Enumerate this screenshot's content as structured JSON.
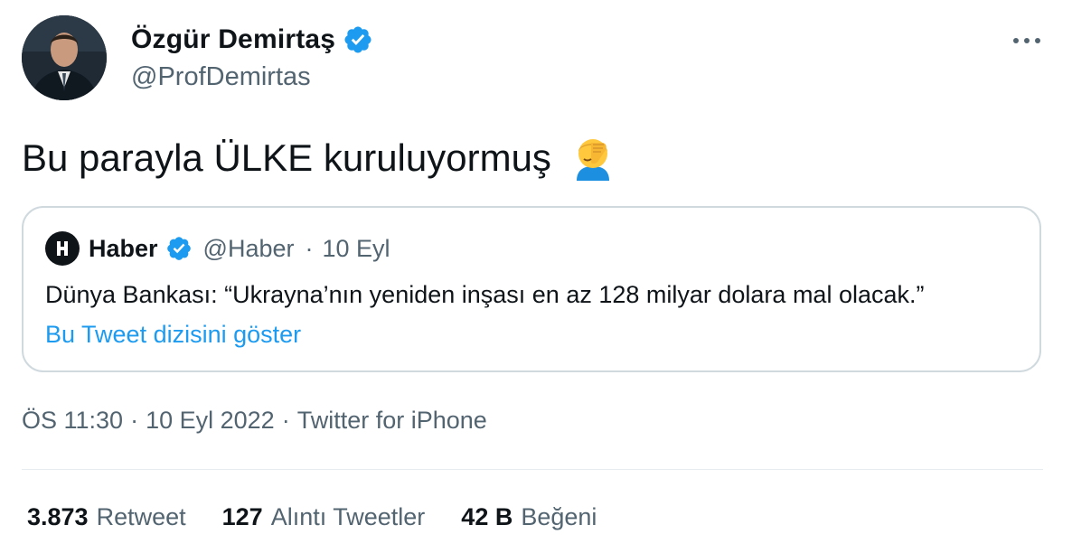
{
  "author": {
    "name": "Özgür Demirtaş",
    "handle": "@ProfDemirtas",
    "verified": true
  },
  "tweet": {
    "text": "Bu parayla ÜLKE kuruluyormuş",
    "emoji": "🤦‍♀️",
    "emoji_icon": "face-palm-icon"
  },
  "quoted": {
    "name": "Haber",
    "handle": "@Haber",
    "separator": "·",
    "date": "10 Eyl",
    "text": "Dünya Bankası: “Ukrayna’nın yeniden inşası en az 128 milyar dolara mal olacak.”",
    "show_thread": "Bu Tweet dizisini göster",
    "logo_letter": "H"
  },
  "meta": {
    "time": "ÖS 11:30",
    "sep1": "·",
    "date": "10 Eyl 2022",
    "sep2": "·",
    "source": "Twitter for iPhone"
  },
  "stats": [
    {
      "count": "3.873",
      "label": "Retweet"
    },
    {
      "count": "127",
      "label": "Alıntı Tweetler"
    },
    {
      "count": "42 B",
      "label": "Beğeni"
    }
  ],
  "colors": {
    "verified": "#1d9bf0",
    "link": "#1d9bf0",
    "secondary_text": "#536471",
    "border": "#cfd9de"
  }
}
